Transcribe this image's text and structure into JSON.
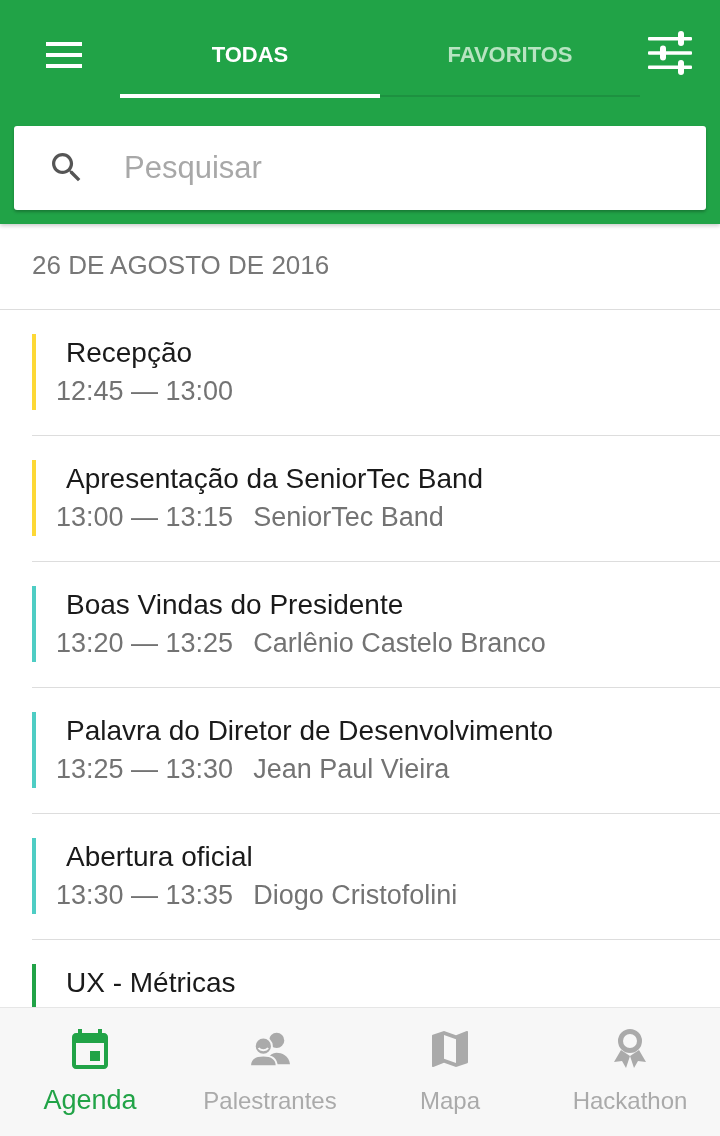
{
  "app_bar": {
    "tabs": [
      {
        "label": "TODAS",
        "selected": true
      },
      {
        "label": "FAVORITOS",
        "selected": false
      }
    ]
  },
  "search": {
    "placeholder": "Pesquisar"
  },
  "agenda": {
    "date_header": "26 DE AGOSTO DE 2016",
    "events": [
      {
        "title": "Recepção",
        "time": "12:45 — 13:00",
        "color": "#fdd835"
      },
      {
        "title": "Apresentação da SeniorTec Band",
        "time": "13:00 — 13:15",
        "speaker": "SeniorTec Band",
        "color": "#fdd835"
      },
      {
        "title": "Boas Vindas do Presidente",
        "time": "13:20 — 13:25",
        "speaker": "Carlênio Castelo Branco",
        "color": "#4ecdc4"
      },
      {
        "title": "Palavra do Diretor de Desenvolvimento",
        "time": "13:25 — 13:30",
        "speaker": "Jean Paul Vieira",
        "color": "#4ecdc4"
      },
      {
        "title": "Abertura oficial",
        "time": "13:30 — 13:35",
        "speaker": "Diogo Cristofolini",
        "color": "#4ecdc4"
      },
      {
        "title": "UX - Métricas",
        "color": "#21a347"
      }
    ]
  },
  "bottom_nav": [
    {
      "label": "Agenda",
      "selected": true
    },
    {
      "label": "Palestrantes",
      "selected": false
    },
    {
      "label": "Mapa",
      "selected": false
    },
    {
      "label": "Hackathon",
      "selected": false
    }
  ]
}
